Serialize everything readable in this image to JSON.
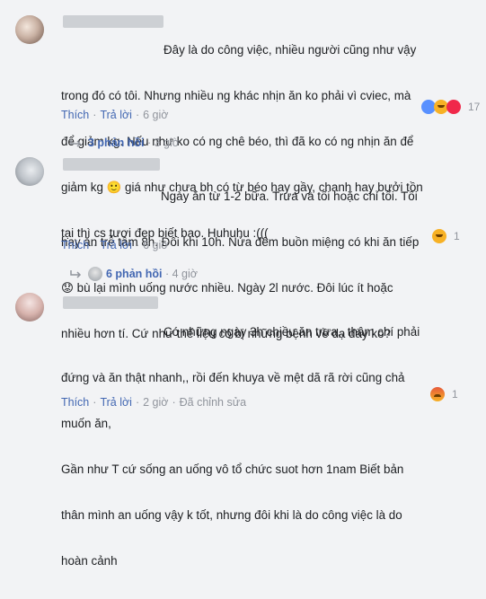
{
  "comments": [
    {
      "text_lines": [
        "Đây là do công việc, nhiều người cũng như vậy",
        "trong đó có tôi. Nhưng nhiều ng khác nhịn ăn ko phải vì cviec, mà",
        "để giảm kg. Nếu như ko có ng chê béo, thì đã ko có ng nhịn ăn để",
        "giảm kg 🙂 giá như chưa bh có từ béo hay gầy, chanh hay bưởi tồn",
        "tại thì cs tươi đẹp biết bao. Huhuhu :((("
      ],
      "actions": {
        "like": "Thích",
        "reply": "Trả lời",
        "time": "6 giờ"
      },
      "reaction_count": "17",
      "reactions": [
        "like",
        "haha",
        "heart"
      ],
      "replies": {
        "label": "3 phản hồi",
        "time": "3 giờ"
      }
    },
    {
      "text_lines": [
        "Ngày ăn từ 1-2 bữa. Trưa và tối hoặc chỉ tối. Tối",
        "hay ăn trễ tầm 8h. Đôi khi 10h. Nửa đêm buồn miệng có khi ăn tiếp",
        "😟 bù lại mình uống nước nhiều. Ngày 2l nước. Đôi lúc ít hoặc",
        "nhiều hơn tí. Cứ như thế liệu có bị những bệnh về dạ dày ko?"
      ],
      "actions": {
        "like": "Thích",
        "reply": "Trả lời",
        "time": "6 giờ"
      },
      "reaction_count": "1",
      "reactions": [
        "haha"
      ],
      "replies": {
        "label": "6 phản hồi",
        "time": "4 giờ"
      }
    },
    {
      "text_lines": [
        "Có những ngày 3h chiều ăn trưa,, thậm chí phải",
        "đứng và ăn thật nhanh,, rồi đến khuya về mệt dã rã rời cũng chả",
        "muốn ăn,",
        "Gần như T cứ sống an uống vô tổ chức suot hơn 1nam Biết bản",
        "thân mình an uống vậy k tốt, nhưng đôi khi là do công việc là do",
        "hoàn cảnh"
      ],
      "actions": {
        "like": "Thích",
        "reply": "Trả lời",
        "time": "2 giờ",
        "edited": "Đã chỉnh sửa"
      },
      "reaction_count": "1",
      "reactions": [
        "angry"
      ]
    }
  ]
}
